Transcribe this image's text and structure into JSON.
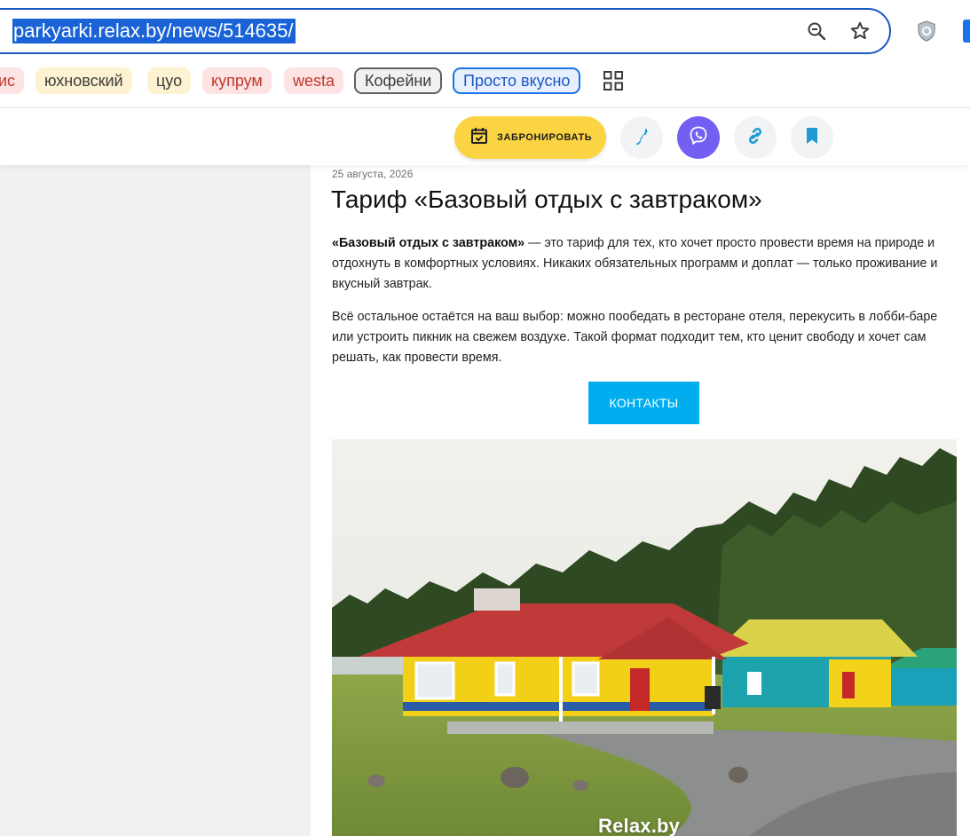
{
  "browser": {
    "url": "parkyarki.relax.by/news/514635/",
    "icons": [
      "zoom-out-icon",
      "star-icon",
      "shield-extension-icon",
      "extension-icon"
    ]
  },
  "bookmarks": [
    {
      "label": "ис",
      "style": "red"
    },
    {
      "label": "юхновский",
      "style": "yellow"
    },
    {
      "label": "цуо",
      "style": "yellow"
    },
    {
      "label": "купрум",
      "style": "red"
    },
    {
      "label": "westa",
      "style": "red"
    },
    {
      "label": "Кофейни",
      "style": "gray"
    },
    {
      "label": "Просто вкусно",
      "style": "blue"
    }
  ],
  "header": {
    "book_label": "ЗАБРОНИРОВАТЬ",
    "icons": [
      "calendar-check-icon",
      "phone-icon",
      "viber-icon",
      "link-icon",
      "bookmark-icon"
    ],
    "colors": {
      "book": "#fbd444",
      "viber": "#7360f2",
      "accent": "#00aeef"
    }
  },
  "article": {
    "date": "25 августа, 2026",
    "title": "Тариф «Базовый отдых с завтраком»",
    "p1_bold": "«Базовый отдых с завтраком»",
    "p1_rest": " — это тариф для тех, кто хочет просто провести время на природе и отдохнуть в комфортных условиях. Никаких обязательных программ и доплат — только проживание и вкусный завтрак.",
    "p2": "Всё остальное остаётся на ваш выбор: можно пообедать в ресторане отеля, перекусить в лобби-баре или устроить пикник на свежем воздухе. Такой формат подходит тем, кто ценит свободу и хочет сам решать, как провести время.",
    "contacts_label": "КОНТАКТЫ",
    "photo_watermark": "Relax.by"
  }
}
